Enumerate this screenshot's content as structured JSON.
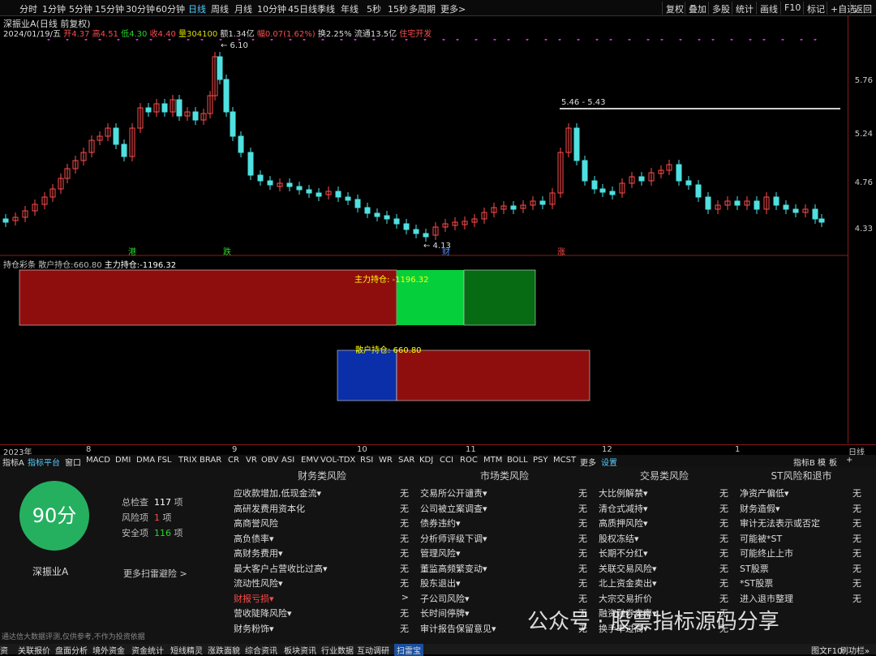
{
  "periods": [
    "分时",
    "1分钟",
    "5分钟",
    "15分钟",
    "30分钟",
    "60分钟",
    "日线",
    "周线",
    "月线",
    "10分钟",
    "45日线",
    "季线",
    "年线",
    "5秒",
    "15秒",
    "多周期",
    "更多>"
  ],
  "active_period": "日线",
  "right_buttons": [
    "复权",
    "叠加",
    "多股",
    "统计",
    "画线",
    "F10",
    "标记",
    "+自选",
    "返回"
  ],
  "stock_title": "深振业A(日线 前复权)",
  "ohlc": {
    "date": "2024/01/19/五",
    "open": "开4.37",
    "high": "高4.51",
    "low": "低4.30",
    "close": "收4.40",
    "volume": "量304100",
    "amount": "额1.34亿",
    "change": "幅0.07(1.62%)",
    "turnover": "换2.25%",
    "float": "流通13.5亿",
    "sector": "住宅开发"
  },
  "price_axis": [
    "5.76",
    "5.24",
    "4.76",
    "4.33"
  ],
  "high_label": "6.10",
  "low_label": "4.13",
  "range_label": "5.46 - 5.43",
  "markers": [
    {
      "t": "港",
      "color": "#2bd42b"
    },
    {
      "t": "跌",
      "color": "#2bd42b"
    },
    {
      "t": "财",
      "color": "#4a8fff"
    },
    {
      "t": "涨",
      "color": "#ff4b4b"
    }
  ],
  "indicator": {
    "name": "持仓彩条",
    "retail_label": "散户持仓:",
    "retail_value": "660.80",
    "main_label": "主力持仓:",
    "main_value": "-1196.32",
    "bar_main_text": "主力持仓: -1196.32",
    "bar_retail_text": "散户持仓: 660.80"
  },
  "dates": [
    "2023年",
    "8",
    "9",
    "10",
    "11",
    "12",
    "1",
    "日线"
  ],
  "tabs": [
    "指标A",
    "指标平台",
    "窗口",
    "MACD",
    "DMI",
    "DMA",
    "FSL",
    "TRIX",
    "BRAR",
    "CR",
    "VR",
    "OBV",
    "ASI",
    "EMV",
    "VOL-TDX",
    "RSI",
    "WR",
    "SAR",
    "KDJ",
    "CCI",
    "ROC",
    "MTM",
    "BOLL",
    "PSY",
    "MCST",
    "更多",
    "设置"
  ],
  "tabs_right": [
    "指标B",
    "模",
    "板",
    "+"
  ],
  "score": {
    "value": "90分",
    "name": "深振业A",
    "total_label": "总检查",
    "total": "117",
    "total_unit": "项",
    "risk_label": "风险项",
    "risk": "1",
    "risk_unit": "项",
    "safe_label": "安全项",
    "safe": "116",
    "safe_unit": "项",
    "more": "更多扫雷避险 >"
  },
  "columns": [
    {
      "title": "财务类风险",
      "rows": [
        [
          "应收款增加,低现金流▾",
          "无"
        ],
        [
          "高研发费用资本化",
          "无"
        ],
        [
          "高商誉风险",
          "无"
        ],
        [
          "高负债率▾",
          "无"
        ],
        [
          "高财务费用▾",
          "无"
        ],
        [
          "最大客户占营收比过高▾",
          "无"
        ],
        [
          "流动性风险▾",
          "无"
        ],
        [
          "财报亏损▾",
          ">"
        ],
        [
          "营收陡降风险▾",
          "无"
        ],
        [
          "财务粉饰▾",
          "无"
        ]
      ]
    },
    {
      "title": "市场类风险",
      "rows": [
        [
          "交易所公开谴责▾",
          "无"
        ],
        [
          "公司被立案调查▾",
          "无"
        ],
        [
          "债券违约▾",
          "无"
        ],
        [
          "分析师评级下调▾",
          "无"
        ],
        [
          "管理风险▾",
          "无"
        ],
        [
          "董监高频繁变动▾",
          "无"
        ],
        [
          "股东退出▾",
          "无"
        ],
        [
          "子公司风险▾",
          "无"
        ],
        [
          "长时间停牌▾",
          "无"
        ],
        [
          "审计报告保留意见▾",
          "无"
        ]
      ]
    },
    {
      "title": "交易类风险",
      "rows": [
        [
          "大比例解禁▾",
          "无"
        ],
        [
          "清仓式减持▾",
          "无"
        ],
        [
          "高质押风险▾",
          "无"
        ],
        [
          "股权冻结▾",
          "无"
        ],
        [
          "长期不分红▾",
          "无"
        ],
        [
          "关联交易风险▾",
          "无"
        ],
        [
          "北上资金卖出▾",
          "无"
        ],
        [
          "大宗交易折价",
          "无"
        ],
        [
          "融资融券卖率▾",
          "无"
        ],
        [
          "换手率过高▾",
          "无"
        ]
      ]
    },
    {
      "title": "ST风险和退市",
      "rows": [
        [
          "净资产偏低▾",
          "无"
        ],
        [
          "财务造假▾",
          "无"
        ],
        [
          "审计无法表示或否定",
          "无"
        ],
        [
          "可能被*ST",
          "无"
        ],
        [
          "可能终止上市",
          "无"
        ],
        [
          "ST股票",
          "无"
        ],
        [
          "*ST股票",
          "无"
        ],
        [
          "进入退市整理",
          "无"
        ]
      ]
    }
  ],
  "disclaimer": "通达信大数据评测,仅供参考,不作为投资依据",
  "bottom_tabs": [
    "资",
    "关联报价",
    "盘面分析",
    "境外资金",
    "资金统计",
    "短线精灵",
    "涨跌面貌",
    "综合资讯",
    "板块资讯",
    "行业数据",
    "互动调研",
    "扫雷宝"
  ],
  "bottom_right": [
    "图文F10",
    "刷功栏»"
  ],
  "watermark": "公众号 · 股票指标源码分享"
}
